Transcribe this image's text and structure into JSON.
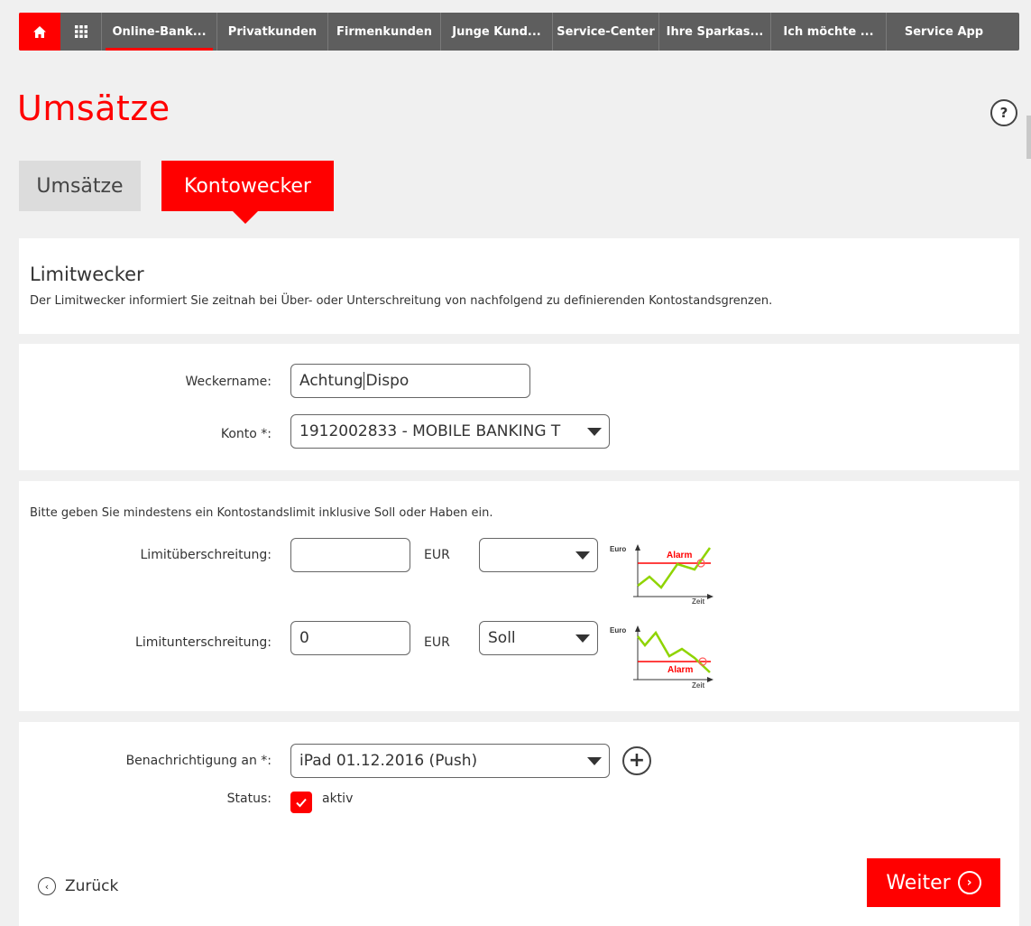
{
  "topnav": {
    "items": [
      "Online-Bank...",
      "Privatkunden",
      "Firmenkunden",
      "Junge Kund...",
      "Service-Center",
      "Ihre Sparkas...",
      "Ich möchte ...",
      "Service App"
    ]
  },
  "page": {
    "title": "Umsätze",
    "help": "?"
  },
  "tabs": {
    "umsaetze": "Umsätze",
    "kontowecker": "Kontowecker"
  },
  "intro": {
    "heading": "Limitwecker",
    "text": "Der Limitwecker informiert Sie zeitnah bei Über- oder Unterschreitung von nachfolgend zu definierenden Kontostandsgrenzen."
  },
  "account": {
    "weckername_label": "Weckername:",
    "weckername_value_a": "Achtung",
    "weckername_value_b": "Dispo",
    "konto_label": "Konto *:",
    "konto_value": "1912002833 - MOBILE BANKING T"
  },
  "limits": {
    "hint": "Bitte geben Sie mindestens ein Kontostandslimit inklusive Soll oder Haben ein.",
    "over_label": "Limitüberschreitung:",
    "over_value": "",
    "over_currency": "EUR",
    "over_type": "",
    "under_label": "Limitunterschreitung:",
    "under_value": "0",
    "under_currency": "EUR",
    "under_type": "Soll",
    "chart_euro": "Euro",
    "chart_alarm": "Alarm",
    "chart_zeit": "Zeit"
  },
  "notify": {
    "label": "Benachrichtigung an *:",
    "value": "iPad 01.12.2016 (Push)",
    "add": "+",
    "status_label": "Status:",
    "status_value": "aktiv",
    "back": "Zurück",
    "next": "Weiter"
  },
  "colors": {
    "brand_red": "#ff0000",
    "nav_gray": "#5e5e5e",
    "chart_green": "#8fd400"
  }
}
